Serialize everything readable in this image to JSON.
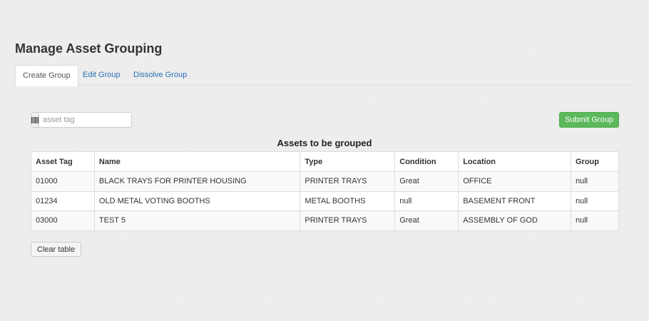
{
  "page": {
    "title": "Manage Asset Grouping"
  },
  "tabs": [
    {
      "label": "Create Group"
    },
    {
      "label": "Edit Group"
    },
    {
      "label": "Dissolve Group"
    }
  ],
  "search": {
    "icon": "barcode-icon",
    "placeholder": "asset tag",
    "value": ""
  },
  "actions": {
    "submit_label": "Submit Group",
    "clear_label": "Clear table"
  },
  "table": {
    "title": "Assets to be grouped",
    "columns": [
      "Asset Tag",
      "Name",
      "Type",
      "Condition",
      "Location",
      "Group"
    ],
    "rows": [
      [
        "01000",
        "BLACK TRAYS FOR PRINTER HOUSING",
        "PRINTER TRAYS",
        "Great",
        "OFFICE",
        "null"
      ],
      [
        "01234",
        "OLD METAL VOTING BOOTHS",
        "METAL BOOTHS",
        "null",
        "BASEMENT FRONT",
        "null"
      ],
      [
        "03000",
        "TEST 5",
        "PRINTER TRAYS",
        "Great",
        "ASSEMBLY OF GOD",
        "null"
      ]
    ]
  },
  "colors": {
    "accent": "#2a6fb5",
    "success": "#5cb85c"
  }
}
